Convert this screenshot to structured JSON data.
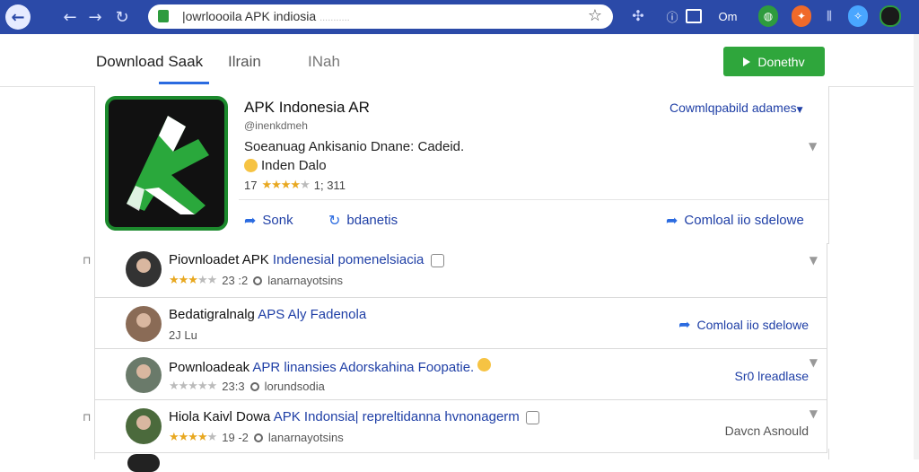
{
  "browser": {
    "url": "|owrloooila APK indiosia",
    "url_suffix": "...........",
    "ext_text": "Om"
  },
  "header": {
    "tabs": [
      "Download Saak",
      "Ilrain",
      "INah"
    ],
    "download_button": "Donethv"
  },
  "app": {
    "title": "APK Indonesia AR",
    "developer": "@inenkdmeh",
    "description": "Soeanuag Ankisanio Dnane: Cadeid.",
    "language": "Inden Dalo",
    "rating_prefix": "17",
    "rating_value": 4,
    "rating_count": "1; 311",
    "top_link": "Cowmlqpabild adames",
    "actions": [
      {
        "icon": "share-icon",
        "label": "Sonk"
      },
      {
        "icon": "sync-icon",
        "label": "bdanetis"
      },
      {
        "icon": "share-icon",
        "label": "Comloal iio sdelowe"
      }
    ]
  },
  "list": [
    {
      "title_plain": "Piovnloadet APK ",
      "title_link": "Indenesial pomenelsiacia",
      "rating_value": 3,
      "meta_count": "23 :2",
      "meta_text": "lanarnayotsins",
      "right_text": ""
    },
    {
      "title_plain": "Bedatigralnalg ",
      "title_link": "APS Aly Fadenola",
      "sub_text": "2J Lu",
      "right_text": "Comloal iio sdelowe"
    },
    {
      "title_plain": "Pownloadeak ",
      "title_link": "APR linansies Adorskahina Foopatie.",
      "rating_value": 0,
      "meta_count": "23:3",
      "meta_text": "lorundsodia",
      "right_text": "Sr0 lreadlase"
    },
    {
      "title_plain": "Hiola Kaivl Dowa ",
      "title_link": "APK Indonsia| repreltidanna hvnonagerm",
      "rating_value": 4,
      "meta_count": "19 -2",
      "meta_text": "lanarnayotsins",
      "right_text": "Davcn Asnould"
    }
  ],
  "colors": {
    "chrome_blue": "#2b4aa8",
    "green": "#2fa63c",
    "link_blue": "#1f3fa6",
    "star": "#e8a820"
  }
}
